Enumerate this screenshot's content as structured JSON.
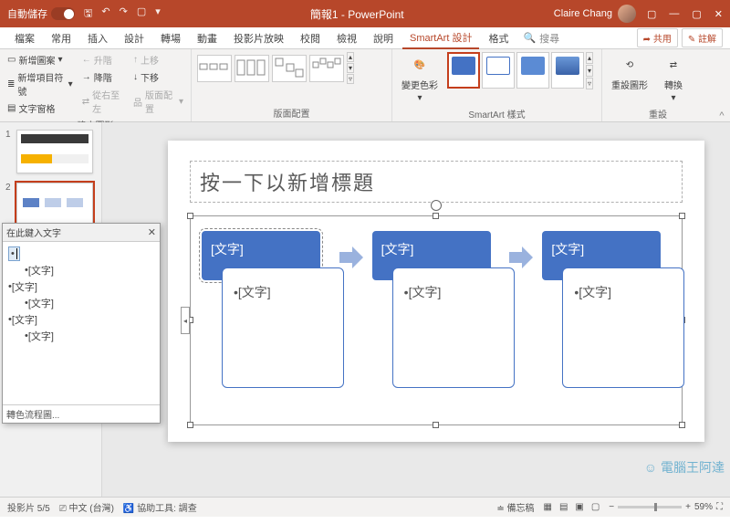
{
  "titlebar": {
    "autosave_label": "自動儲存",
    "title": "簡報1 - PowerPoint",
    "user_name": "Claire Chang"
  },
  "tabs": {
    "items": [
      "檔案",
      "常用",
      "插入",
      "設計",
      "轉場",
      "動畫",
      "投影片放映",
      "校閱",
      "檢視",
      "說明",
      "SmartArt 設計",
      "格式"
    ],
    "active_index": 10,
    "search_label": "搜尋",
    "share": "共用",
    "comments": "註解"
  },
  "ribbon": {
    "g1": {
      "add_shape": "新增圖案",
      "add_bullet": "新增項目符號",
      "text_pane": "文字窗格",
      "promote": "升階",
      "demote": "降階",
      "rtl": "從右至左",
      "move_up": "上移",
      "move_down": "下移",
      "layout": "版面配置",
      "label": "建立圖形"
    },
    "g2": {
      "label": "版面配置"
    },
    "g3": {
      "change_colors": "變更色彩",
      "label": "SmartArt 樣式"
    },
    "g4": {
      "reset": "重設圖形",
      "convert": "轉換",
      "label": "重設"
    }
  },
  "text_pane": {
    "title": "在此鍵入文字",
    "footer": "轉色流程圖...",
    "items": [
      {
        "level": 1,
        "text": "",
        "active": true
      },
      {
        "level": 2,
        "text": "[文字]"
      },
      {
        "level": 1,
        "text": "[文字]"
      },
      {
        "level": 2,
        "text": "[文字]"
      },
      {
        "level": 1,
        "text": "[文字]"
      },
      {
        "level": 2,
        "text": "[文字]"
      }
    ]
  },
  "slide": {
    "title_placeholder": "按一下以新增標題",
    "block_label": "[文字]",
    "bullet_label": "[文字]"
  },
  "status": {
    "slide_count": "投影片 5/5",
    "lang": "中文 (台灣)",
    "a11y": "協助工具: 調查",
    "notes": "備忘稿",
    "zoom": "59%"
  },
  "watermark": "電腦王阿達"
}
